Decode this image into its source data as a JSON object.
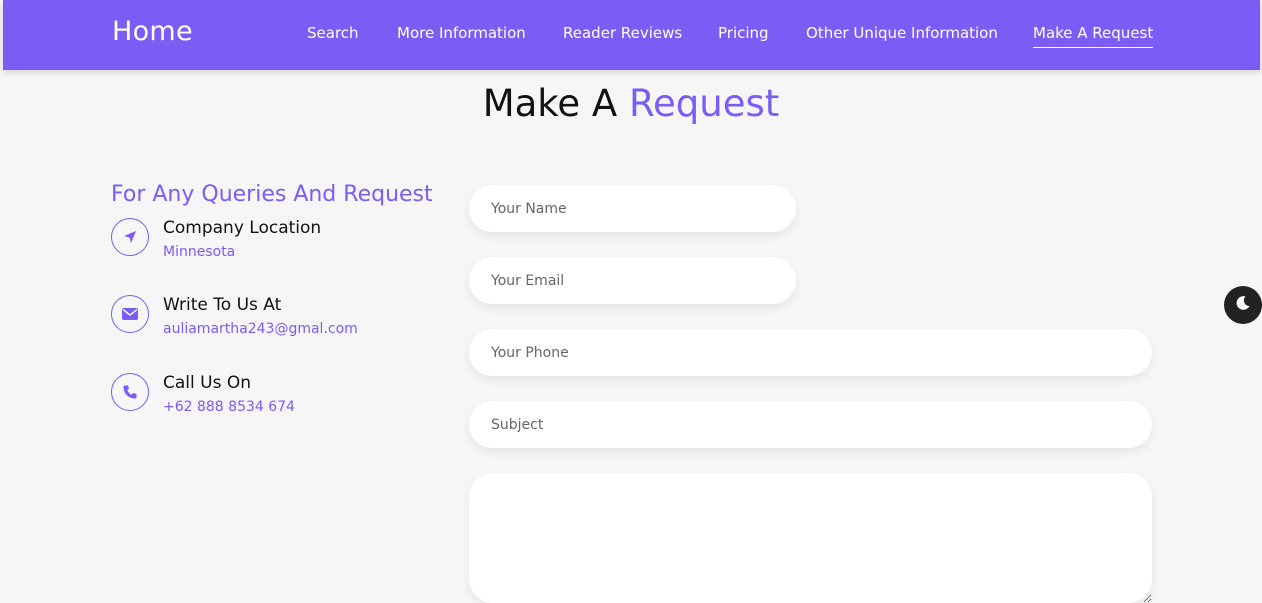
{
  "nav": {
    "brand": "Home",
    "links": [
      {
        "label": "Search"
      },
      {
        "label": "More Information"
      },
      {
        "label": "Reader Reviews"
      },
      {
        "label": "Pricing"
      },
      {
        "label": "Other Unique Information"
      },
      {
        "label": "Make A Request",
        "active": true
      }
    ]
  },
  "page": {
    "title_plain": "Make A",
    "title_accent": "Request"
  },
  "contact": {
    "heading": "For Any Queries And Request",
    "items": [
      {
        "icon": "location-arrow-icon",
        "title": "Company Location",
        "value": "Minnesota"
      },
      {
        "icon": "envelope-icon",
        "title": "Write To Us At",
        "value": "auliamartha243@gmal.com"
      },
      {
        "icon": "phone-icon",
        "title": "Call Us On",
        "value": "+62 888 8534 674"
      }
    ]
  },
  "form": {
    "name_placeholder": "Your Name",
    "email_placeholder": "Your Email",
    "phone_placeholder": "Your Phone",
    "subject_placeholder": "Subject",
    "message_value": ""
  },
  "theme_toggle": {
    "icon": "moon-icon"
  },
  "colors": {
    "accent": "#7b5cf5",
    "background": "#f6f6f6",
    "toggle": "#222222"
  }
}
